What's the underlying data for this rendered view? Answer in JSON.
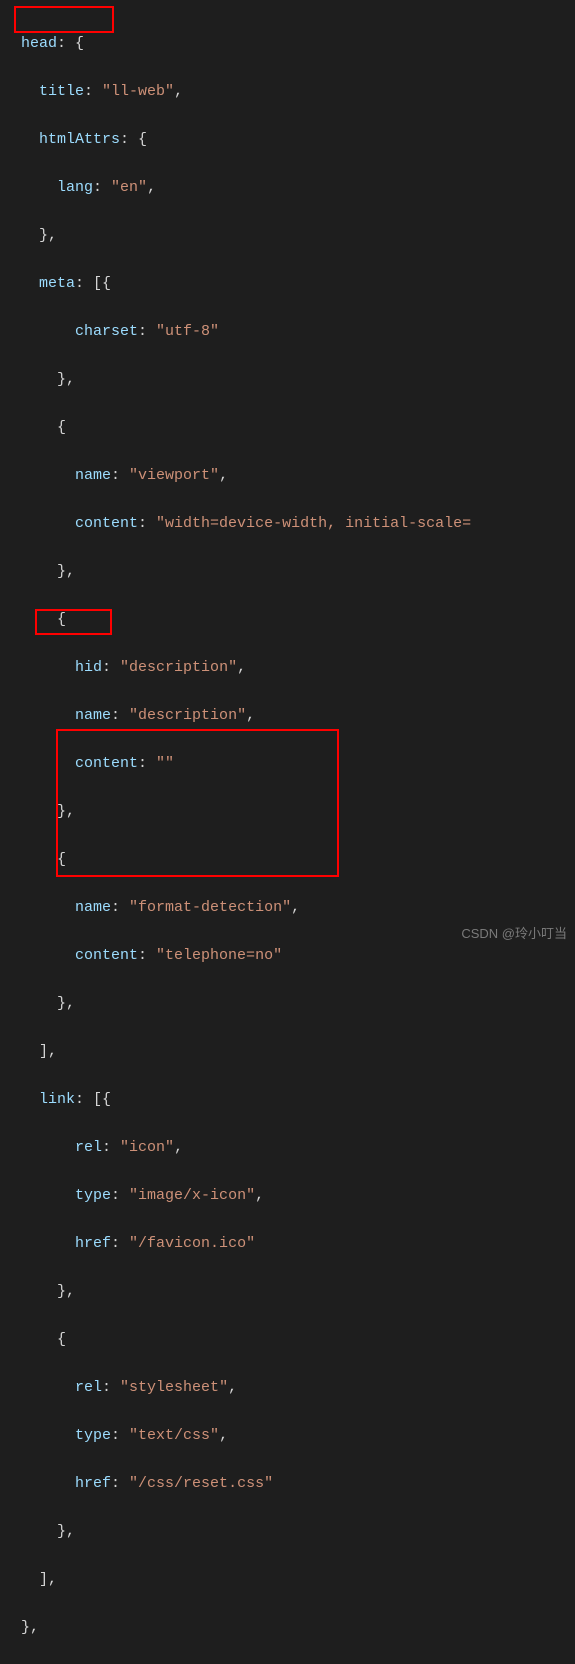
{
  "indent": "   ",
  "tokens": {
    "head": "head",
    "title": "title",
    "htmlAttrs": "htmlAttrs",
    "lang": "lang",
    "meta": "meta",
    "charset": "charset",
    "name": "name",
    "content": "content",
    "hid": "hid",
    "link": "link",
    "rel": "rel",
    "type": "type",
    "href": "href"
  },
  "values": {
    "title": "\"ll-web\"",
    "lang": "\"en\"",
    "charset": "\"utf-8\"",
    "viewport_name": "\"viewport\"",
    "viewport_content": "\"width=device-width, initial-scale=",
    "desc_hid": "\"description\"",
    "desc_name": "\"description\"",
    "desc_content": "\"\"",
    "format_name": "\"format-detection\"",
    "format_content": "\"telephone=no\"",
    "icon_rel": "\"icon\"",
    "icon_type": "\"image/x-icon\"",
    "icon_href": "\"/favicon.ico\"",
    "css_rel": "\"stylesheet\"",
    "css_type": "\"text/css\"",
    "css_href": "\"/css/reset.css\""
  },
  "watermark": "CSDN @玲小叮当"
}
